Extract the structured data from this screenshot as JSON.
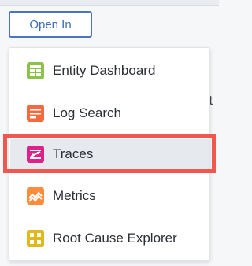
{
  "toolbar": {
    "open_in_label": "Open In"
  },
  "background": {
    "partial_text": "nt"
  },
  "menu": {
    "items": [
      {
        "label": "Entity Dashboard",
        "icon": "entity-dashboard-icon",
        "color": "#8bc34a"
      },
      {
        "label": "Log Search",
        "icon": "log-search-icon",
        "color": "#f26a3d"
      },
      {
        "label": "Traces",
        "icon": "traces-icon",
        "color": "#e0218a",
        "selected": true
      },
      {
        "label": "Metrics",
        "icon": "metrics-icon",
        "color": "#ff8c3a"
      },
      {
        "label": "Root Cause Explorer",
        "icon": "root-cause-explorer-icon",
        "color": "#e2b81f"
      }
    ]
  },
  "colors": {
    "accent": "#4a76c1",
    "highlight": "#f0574f"
  }
}
